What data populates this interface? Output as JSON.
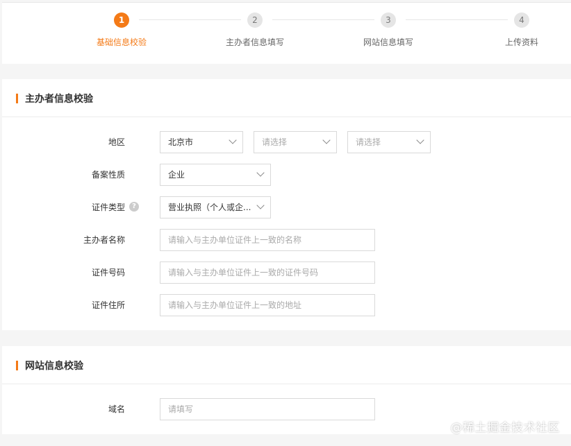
{
  "steps": [
    {
      "num": "1",
      "label": "基础信息校验",
      "active": true
    },
    {
      "num": "2",
      "label": "主办者信息填写",
      "active": false
    },
    {
      "num": "3",
      "label": "网站信息填写",
      "active": false
    },
    {
      "num": "4",
      "label": "上传资料",
      "active": false
    }
  ],
  "sponsor_section": {
    "title": "主办者信息校验",
    "region_label": "地区",
    "region_province": "北京市",
    "region_city_placeholder": "请选择",
    "region_district_placeholder": "请选择",
    "filing_nature_label": "备案性质",
    "filing_nature_value": "企业",
    "cert_type_label": "证件类型",
    "cert_type_help": "?",
    "cert_type_value": "营业执照（个人或企...",
    "sponsor_name_label": "主办者名称",
    "sponsor_name_placeholder": "请输入与主办单位证件上一致的名称",
    "cert_number_label": "证件号码",
    "cert_number_placeholder": "请输入与主办单位证件上一致的证件号码",
    "cert_address_label": "证件住所",
    "cert_address_placeholder": "请输入与主办单位证件上一致的地址"
  },
  "website_section": {
    "title": "网站信息校验",
    "domain_label": "域名",
    "domain_placeholder": "请填写"
  },
  "watermark": "@稀土掘金技术社区",
  "colors": {
    "accent": "#f47a17",
    "page_bg": "#f5f5f5"
  }
}
